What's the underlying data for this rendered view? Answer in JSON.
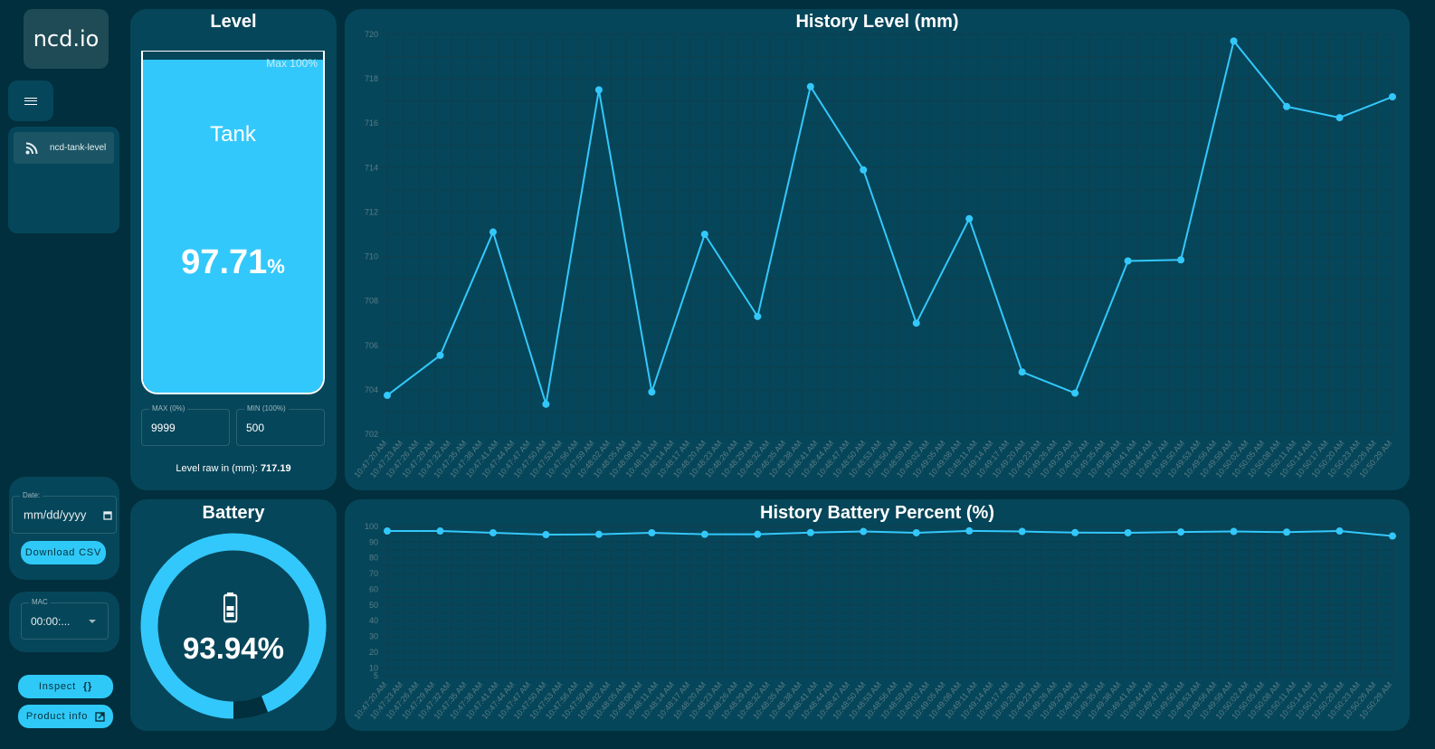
{
  "sidebar": {
    "logo": "ncd.io",
    "menu_icon": "hamburger-icon",
    "nav_items": [
      {
        "label": "ncd-tank-level",
        "icon": "rss-feed-icon"
      }
    ],
    "date_field": {
      "legend": "Date:",
      "placeholder": "mm/dd/yyyy",
      "icon": "calendar-icon"
    },
    "download_button": "Download CSV",
    "mac_field": {
      "legend": "MAC",
      "value": "00:00:...",
      "icon": "caret-down-icon"
    },
    "inspect_button": {
      "label": "Inspect",
      "icon_glyph": "{}"
    },
    "product_info_button": {
      "label": "Product info",
      "icon": "external-link-icon"
    }
  },
  "level_card": {
    "title": "Level",
    "tank_label": "Tank",
    "max_label": "Max 100%",
    "percent_value": "97.71",
    "percent_unit": "%",
    "fill_percent": 97.71,
    "max_field": {
      "legend": "MAX (0%)",
      "value": "9999"
    },
    "min_field": {
      "legend": "MIN (100%)",
      "value": "500"
    },
    "raw_label": "Level raw in (mm):",
    "raw_value": "717.19"
  },
  "battery_card": {
    "title": "Battery",
    "value": "93.94%",
    "percent": 93.94,
    "icon": "battery-icon"
  },
  "colors": {
    "accent": "#33c8fb",
    "card_bg": "#06465a",
    "page_bg": "#022f3d",
    "tick_text": "#5a7c86",
    "grid": "#0f3f4e"
  },
  "chart_data": [
    {
      "type": "line",
      "title": "History Level (mm)",
      "xlabel": "",
      "ylabel": "",
      "ylim": [
        702,
        720
      ],
      "yticks": [
        702,
        704,
        706,
        708,
        710,
        712,
        714,
        716,
        718,
        720
      ],
      "grid": true,
      "x_tick_labels": [
        "10:47:20 AM",
        "10:47:23 AM",
        "10:47:26 AM",
        "10:47:29 AM",
        "10:47:32 AM",
        "10:47:35 AM",
        "10:47:38 AM",
        "10:47:41 AM",
        "10:47:44 AM",
        "10:47:47 AM",
        "10:47:50 AM",
        "10:47:53 AM",
        "10:47:56 AM",
        "10:47:59 AM",
        "10:48:02 AM",
        "10:48:05 AM",
        "10:48:08 AM",
        "10:48:11 AM",
        "10:48:14 AM",
        "10:48:17 AM",
        "10:48:20 AM",
        "10:48:23 AM",
        "10:48:26 AM",
        "10:48:29 AM",
        "10:48:32 AM",
        "10:48:35 AM",
        "10:48:38 AM",
        "10:48:41 AM",
        "10:48:44 AM",
        "10:48:47 AM",
        "10:48:50 AM",
        "10:48:53 AM",
        "10:48:56 AM",
        "10:48:59 AM",
        "10:49:02 AM",
        "10:49:05 AM",
        "10:49:08 AM",
        "10:49:11 AM",
        "10:49:14 AM",
        "10:49:17 AM",
        "10:49:20 AM",
        "10:49:23 AM",
        "10:49:26 AM",
        "10:49:29 AM",
        "10:49:32 AM",
        "10:49:35 AM",
        "10:49:38 AM",
        "10:49:41 AM",
        "10:49:44 AM",
        "10:49:47 AM",
        "10:49:50 AM",
        "10:49:53 AM",
        "10:49:56 AM",
        "10:49:59 AM",
        "10:50:02 AM",
        "10:50:05 AM",
        "10:50:08 AM",
        "10:50:11 AM",
        "10:50:14 AM",
        "10:50:17 AM",
        "10:50:20 AM",
        "10:50:23 AM",
        "10:50:26 AM",
        "10:50:29 AM"
      ],
      "series": [
        {
          "name": "Level (mm)",
          "values": [
            703.75,
            705.55,
            711.1,
            703.35,
            717.5,
            703.9,
            711.0,
            707.3,
            717.65,
            713.9,
            707.0,
            711.7,
            704.8,
            703.85,
            709.8,
            709.85,
            719.7,
            716.75,
            716.25,
            717.19
          ]
        }
      ]
    },
    {
      "type": "line",
      "title": "History Battery Percent (%)",
      "xlabel": "",
      "ylabel": "",
      "ylim": [
        5,
        100
      ],
      "yticks": [
        5,
        10,
        20,
        30,
        40,
        50,
        60,
        70,
        80,
        90,
        100
      ],
      "grid": true,
      "x_tick_labels": "same-as-level",
      "series": [
        {
          "name": "Battery (%)",
          "values": [
            97.1,
            97.1,
            96.0,
            94.8,
            95.0,
            96.0,
            95.0,
            95.0,
            96.1,
            96.8,
            96.0,
            97.2,
            96.8,
            96.1,
            96.0,
            96.5,
            96.8,
            96.4,
            97.1,
            93.94
          ]
        }
      ]
    }
  ]
}
